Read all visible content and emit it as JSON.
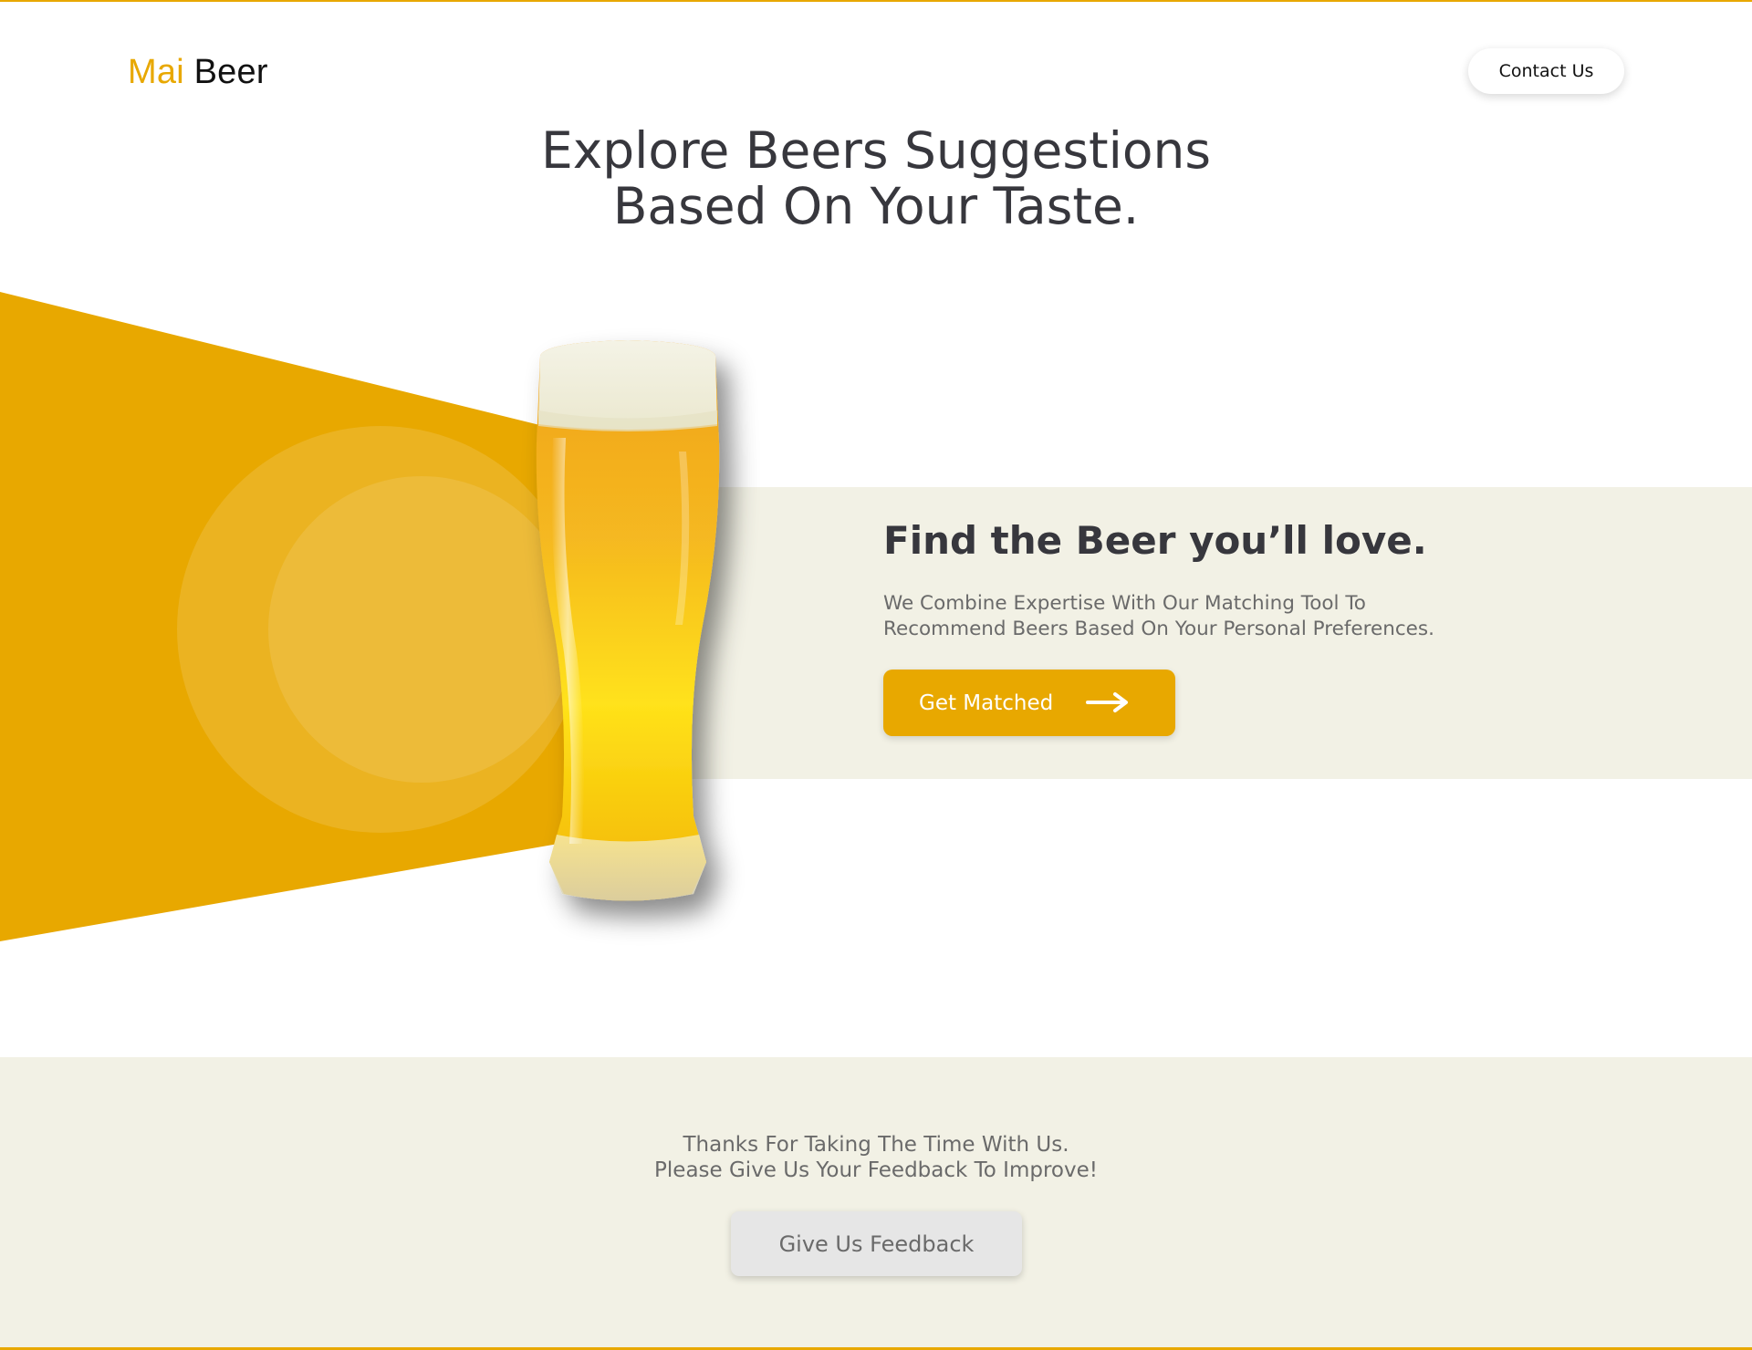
{
  "header": {
    "logo_part1": "Mai",
    "logo_part2": "Beer",
    "contact_label": "Contact Us"
  },
  "hero": {
    "title_line1": "Explore Beers Suggestions",
    "title_line2": "Based On Your Taste."
  },
  "feature": {
    "title": "Find the Beer you’ll love.",
    "desc_line1": "We Combine Expertise With Our Matching Tool To",
    "desc_line2": "Recommend Beers Based On Your Personal Preferences.",
    "button_label": "Get Matched",
    "button_icon": "arrow-right-icon",
    "image": "beer-glass-image"
  },
  "footer": {
    "thanks_line1": "Thanks For Taking The Time With Us.",
    "thanks_line2": "Please Give Us Your Feedback To Improve!",
    "feedback_label": "Give Us Feedback"
  },
  "colors": {
    "accent": "#e8a800",
    "band": "#f2f1e5",
    "text_dark": "#37373d",
    "text_muted": "#6a6a6a"
  }
}
